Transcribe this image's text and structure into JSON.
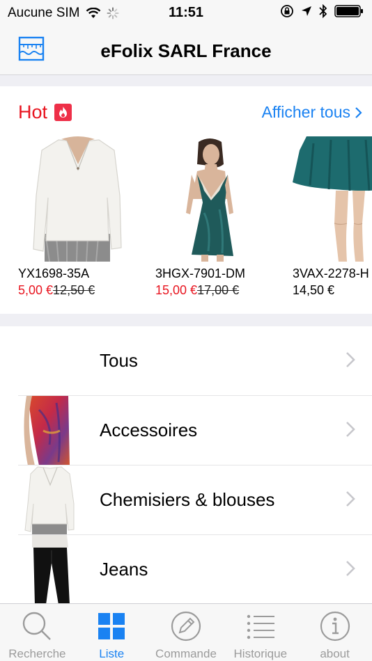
{
  "status_bar": {
    "carrier": "Aucune SIM",
    "time": "11:51"
  },
  "navbar": {
    "title": "eFolix SARL France"
  },
  "hot": {
    "title": "Hot",
    "show_all": "Afficher tous",
    "products": [
      {
        "sku": "YX1698-35A",
        "sale_price": "5,00 €",
        "original_price": "12,50 €",
        "regular_price": ""
      },
      {
        "sku": "3HGX-7901-DM",
        "sale_price": "15,00 €",
        "original_price": "17,00 €",
        "regular_price": ""
      },
      {
        "sku": "3VAX-2278-H",
        "sale_price": "",
        "original_price": "",
        "regular_price": "14,50 €"
      }
    ]
  },
  "categories": [
    {
      "label": "Tous"
    },
    {
      "label": "Accessoires"
    },
    {
      "label": "Chemisiers & blouses"
    },
    {
      "label": "Jeans"
    }
  ],
  "tabbar": {
    "tabs": [
      {
        "label": "Recherche",
        "icon": "magnifier-icon",
        "active": false
      },
      {
        "label": "Liste",
        "icon": "grid-icon",
        "active": true
      },
      {
        "label": "Commande",
        "icon": "pencil-icon",
        "active": false
      },
      {
        "label": "Historique",
        "icon": "list-icon",
        "active": false
      },
      {
        "label": "about",
        "icon": "info-icon",
        "active": false
      }
    ]
  },
  "colors": {
    "accent": "#1a82f2",
    "sale": "#e8141f",
    "hot_badge": "#ee2f48"
  }
}
